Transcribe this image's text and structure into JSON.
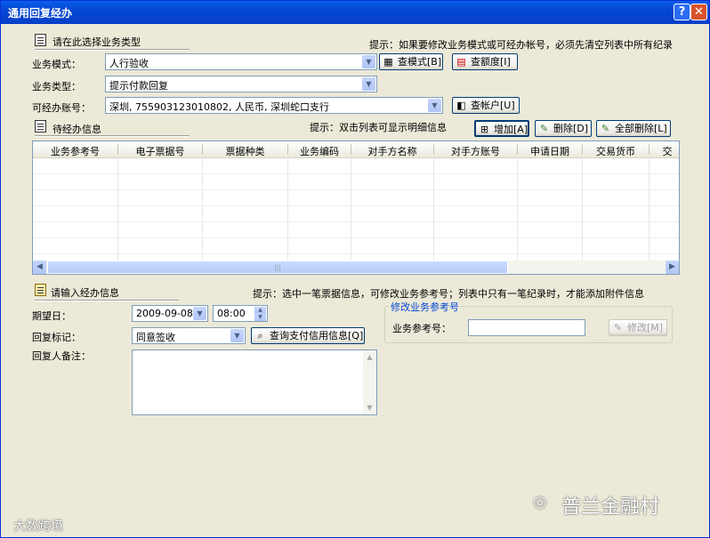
{
  "window": {
    "title": "通用回复经办",
    "help_btn": "?",
    "close_btn": "✕"
  },
  "section1": {
    "title": "请在此选择业务类型",
    "hint": "提示：如果要修改业务模式或可经办帐号，必须先清空列表中所有纪录"
  },
  "biz_mode": {
    "label": "业务模式：",
    "value": "人行验收"
  },
  "biz_type": {
    "label": "业务类型：",
    "value": "提示付款回复"
  },
  "account": {
    "label": "可经办账号：",
    "value": "深圳, 755903123010802, 人民币, 深圳蛇口支行"
  },
  "buttons": {
    "query_mode": "查模式[B]",
    "query_quota": "查额度[I]",
    "query_account": "查帐户[U]",
    "add": "增加[A]",
    "delete": "删除[D]",
    "delete_all": "全部删除[L]",
    "query_credit": "查询支付信用信息[Q]",
    "modify": "修改[M]"
  },
  "section2": {
    "title": "待经办信息",
    "hint": "提示：双击列表可显示明细信息"
  },
  "table": {
    "columns": [
      "业务参考号",
      "电子票据号",
      "票据种类",
      "业务编码",
      "对手方名称",
      "对手方账号",
      "申请日期",
      "交易货币",
      "交"
    ],
    "rows": []
  },
  "section3": {
    "title": "请输入经办信息",
    "hint": "提示：选中一笔票据信息，可修改业务参考号；列表中只有一笔纪录时，才能添加附件信息"
  },
  "expected_date": {
    "label": "期望日：",
    "date": "2009-09-08",
    "time": "08:00"
  },
  "reply_flag": {
    "label": "回复标记：",
    "value": "同意签收"
  },
  "remark": {
    "label": "回复人备注："
  },
  "ref_group": {
    "title": "修改业务参考号",
    "label": "业务参考号："
  },
  "watermarks": {
    "left": "大数跨境",
    "right": "普兰金融村"
  }
}
